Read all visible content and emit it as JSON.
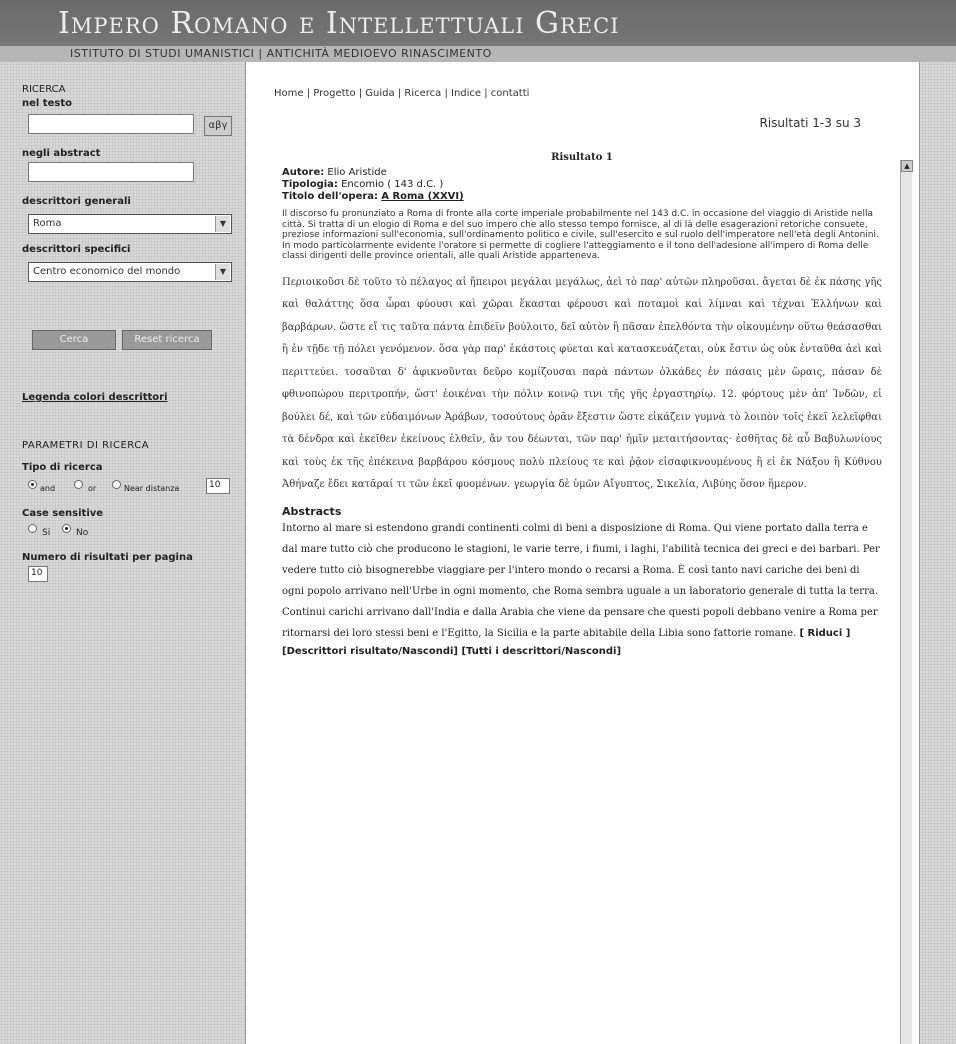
{
  "header": {
    "title": "Impero Romano e Intellettuali Greci",
    "subtitle": "ISTITUTO DI STUDI UMANISTICI | ANTICHITÀ MEDIOEVO RINASCIMENTO"
  },
  "sidebar": {
    "ricerca": "RICERCA",
    "nel_testo": "nel testo",
    "text_search_value": "",
    "greek_key": "αβγ",
    "negli_abstract": "negli abstract",
    "abstract_value": "",
    "descrittori_generali": "descrittori generali",
    "generali_selected": "Roma",
    "descrittori_specifici": "descrittori specifici",
    "specifici_selected": "Centro economico del mondo",
    "cerca": "Cerca",
    "reset": "Reset ricerca",
    "legenda": "Legenda colori descrittori",
    "parametri": "PARAMETRI DI RICERCA",
    "tipo_ricerca": "Tipo di ricerca",
    "tipo_options": [
      "and",
      "or",
      "Near distanza"
    ],
    "near_value": "10",
    "case_sensitive": "Case sensitive",
    "case_options": [
      "Si",
      "No"
    ],
    "numero_risultati": "Numero di risultati per pagina",
    "numero_value": "10"
  },
  "main": {
    "topnav": "Home | Progetto | Guida | Ricerca | Indice | contatti",
    "count": "Risultati 1-3 su 3",
    "result_title": "Risultato 1",
    "autore_label": "Autore:",
    "autore_value": "Elio Aristide",
    "tipologia_label": "Tipologia:",
    "tipologia_value": "Encomio ( 143 d.C. )",
    "titolo_label": "Titolo dell'opera:",
    "titolo_value": "A Roma (XXVI)",
    "description": "Il discorso fu pronunziato a Roma di fronte alla corte imperiale probabilmente nel 143 d.C. in occasione del viaggio di Aristide nella città. Si tratta di un elogio di Roma e del suo impero che allo stesso tempo fornisce, al di là delle esagerazioni retoriche consuete, preziose informazioni sull'economia, sull'ordinamento politico e civile, sull'esercito e sul ruolo dell'imperatore nell'età degli Antonini. In modo particolarmente evidente l'oratore si permette di cogliere l'atteggiamento e il tono dell'adesione all'impero di Roma delle classi dirigenti delle province orientali, alle quali Aristide apparteneva.",
    "greek_text": "Περιοικοῦσι δὲ τοῦτο τὸ πέλαγος αἱ ἤπειροι μεγάλαι μεγάλως, ἀεὶ τὸ παρ' αὐτῶν πληροῦσαι. ἄγεται δὲ ἐκ πάσης γῆς καὶ θαλάττης ὅσα ὧραι φύουσι καὶ χῶραι ἕκασται φέρουσι καὶ ποταμοὶ καὶ λίμναι καὶ τέχναι Ἑλλήνων καὶ βαρβάρων. ὥστε εἴ τις ταῦτα πάντα ἐπιδεῖν βούλοιτο, δεῖ αὐτὸν ἢ πᾶσαν ἐπελθόντα τὴν οἰκουμένην οὕτω θεάσασθαι ἢ ἐν τῇδε τῇ πόλει γενόμενον. ὅσα γὰρ παρ' ἑκάστοις φύεται καὶ κατασκευάζεται, οὐκ ἔστιν ὡς οὐκ ἐνταῦθα ἀεὶ καὶ περιττεύει. τοσαῦται δ' ἀφικνοῦνται δεῦρο κομίζουσαι παρὰ πάντων ὁλκάδες ἐν πάσαις μὲν ὥραις, πάσαν δὲ φθινοπώρου περιτροπήν, ὥστ' ἐοικέναι τὴν πόλιν κοινῷ τινι τῆς γῆς ἐργαστηρίῳ. 12. φόρτους μὲν ἀπ' Ἰνδῶν, εἰ βούλει δέ, καὶ τῶν εὐδαιμόνων Ἀράβων, τοσούτους ὁρᾶν ἔξεστιν ὥστε εἰκάζειν γυμνὰ τὸ λοιπὸν τοῖς ἐκεῖ λελεῖφθαι τὰ δένδρα καὶ ἐκεῖθεν ἐκείνους ἐλθεῖν, ἄν του δέωνται, τῶν παρ' ἡμῖν μεταιτήσοντας· ἐσθῆτας δὲ αὖ Βαβυλωνίους καὶ τοὺς ἐκ τῆς ἐπέκεινα βαρβάρου κόσμους πολὺ πλείους τε καὶ ῥᾷον εἰσαφικνουμένους ἢ εἰ ἐκ Νάξου ἢ Κύθνου Ἀθήναζε ἔδει κατᾶραί τι τῶν ἐκεῖ φυομένων. γεωργία δὲ ὑμῶν Αἴγυπτος, Σικελία, Λιβύης ὅσον ἥμερον.",
    "abstracts_label": "Abstracts",
    "abstract_text": "Intorno al mare si estendono grandi continenti colmi di beni a disposizione di Roma. Qui viene portato dalla terra e dal mare tutto ciò che producono le stagioni, le varie terre, i fiumi, i laghi, l'abilità tecnica dei greci e dei barbari. Per vedere tutto ciò bisognerebbe viaggiare per l'intero mondo o recarsi a Roma. È così tanto navi cariche dei beni di ogni popolo arrivano nell'Urbe in ogni momento, che Roma sembra uguale a un laboratorio generale di tutta la terra. Continui carichi arrivano dall'India e dalla Arabia che viene da pensare che questi popoli debbano venire a Roma per ritornarsi dei loro stessi beni e l'Egitto, la Sicilia e la parte abitabile della Libia sono fattorie romane.",
    "riduci": "[ Riduci ]",
    "descrittori_links": "[Descrittori risultato/Nascondi] [Tutti i descrittori/Nascondi]"
  }
}
